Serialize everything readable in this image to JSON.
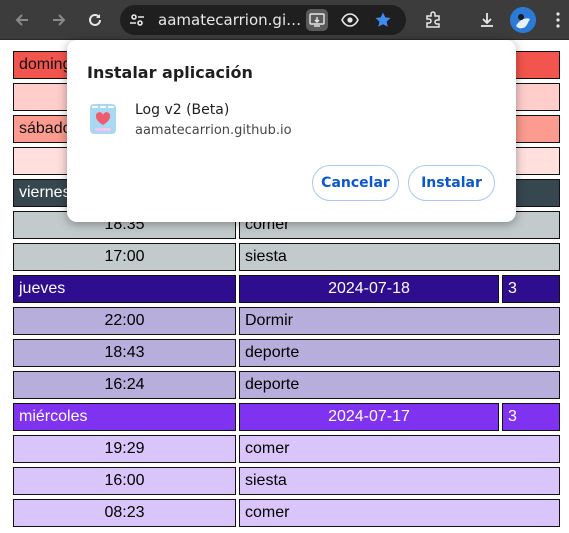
{
  "browser": {
    "url": "aamatecarrion.github.io",
    "url_display": "aamatecarrion.githu...",
    "icons": [
      "back-arrow-icon",
      "forward-arrow-icon",
      "reload-icon",
      "site-info-icon",
      "install-app-icon",
      "eye-icon",
      "bookmark-star-icon",
      "extensions-icon",
      "download-icon",
      "profile-avatar",
      "menu-icon"
    ],
    "accent": "#2b7bd6"
  },
  "dialog": {
    "title": "Instalar aplicación",
    "app_name": "Log v2 (Beta)",
    "app_host": "aamatecarrion.github.io",
    "cancel_label": "Cancelar",
    "install_label": "Instalar",
    "button_color": "#0b57d0"
  },
  "log": {
    "rows": [
      {
        "type": "day",
        "day": "domingo",
        "date": "",
        "count": "",
        "bg": "#f2554d",
        "fg": "#111111"
      },
      {
        "type": "empty",
        "bg": "#ffcdca"
      },
      {
        "type": "day",
        "day": "sábado",
        "date": "",
        "count": "",
        "bg": "#fc9b8f",
        "fg": "#111111"
      },
      {
        "type": "empty",
        "bg": "#ffe0dc"
      },
      {
        "type": "day",
        "day": "viernes",
        "date": "",
        "count": "",
        "bg": "#37474f",
        "fg": "#ffffff"
      },
      {
        "type": "entry",
        "time": "18:35",
        "activity": "comer",
        "bg": "#c2cacb"
      },
      {
        "type": "entry",
        "time": "17:00",
        "activity": "siesta",
        "bg": "#c2cacb"
      },
      {
        "type": "day",
        "day": "jueves",
        "date": "2024-07-18",
        "count": "3",
        "bg": "#2e0e8f",
        "fg": "#ffffff"
      },
      {
        "type": "entry",
        "time": "22:00",
        "activity": "Dormir",
        "bg": "#b8aedb"
      },
      {
        "type": "entry",
        "time": "18:43",
        "activity": "deporte",
        "bg": "#b8aedb"
      },
      {
        "type": "entry",
        "time": "16:24",
        "activity": "deporte",
        "bg": "#b8aedb"
      },
      {
        "type": "day",
        "day": "miércoles",
        "date": "2024-07-17",
        "count": "3",
        "bg": "#7f32f0",
        "fg": "#ffffff"
      },
      {
        "type": "entry",
        "time": "19:29",
        "activity": "comer",
        "bg": "#d9c5f9"
      },
      {
        "type": "entry",
        "time": "16:00",
        "activity": "siesta",
        "bg": "#d9c5f9"
      },
      {
        "type": "entry",
        "time": "08:23",
        "activity": "comer",
        "bg": "#d9c5f9"
      }
    ]
  }
}
